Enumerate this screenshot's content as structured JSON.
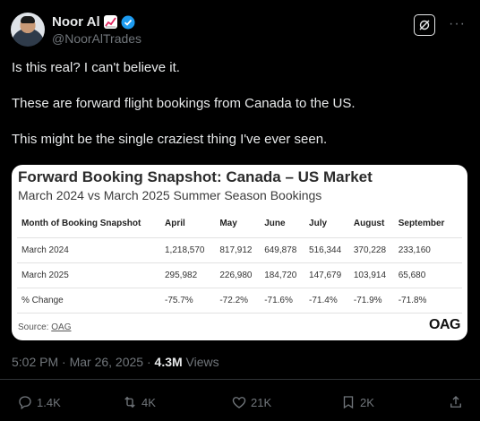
{
  "author": {
    "display_name": "Noor Al",
    "handle": "@NoorAlTrades",
    "icons": [
      "chart-increasing-emoji",
      "verified-badge-icon"
    ]
  },
  "header_actions": {
    "grok_icon": "grok-icon",
    "more_label": "···"
  },
  "tweet": {
    "paragraphs": [
      "Is this real? I can't believe it.",
      "These are forward flight bookings from Canada to the US.",
      "This might be the single craziest thing I've ever seen."
    ]
  },
  "card": {
    "title": "Forward Booking Snapshot: Canada – US Market",
    "subtitle": "March 2024 vs March 2025 Summer Season Bookings",
    "columns": [
      "Month of Booking Snapshot",
      "April",
      "May",
      "June",
      "July",
      "August",
      "September"
    ],
    "rows": [
      [
        "March 2024",
        "1,218,570",
        "817,912",
        "649,878",
        "516,344",
        "370,228",
        "233,160"
      ],
      [
        "March 2025",
        "295,982",
        "226,980",
        "184,720",
        "147,679",
        "103,914",
        "65,680"
      ],
      [
        "% Change",
        "-75.7%",
        "-72.2%",
        "-71.6%",
        "-71.4%",
        "-71.9%",
        "-71.8%"
      ]
    ],
    "source_label": "Source:",
    "source_link": "OAG",
    "logo_text": "OAG"
  },
  "meta": {
    "time": "5:02 PM · Mar 26, 2025 · ",
    "views_count": "4.3M",
    "views_label": " Views"
  },
  "actions": {
    "replies": "1.4K",
    "reposts": "4K",
    "likes": "21K",
    "bookmarks": "2K"
  }
}
